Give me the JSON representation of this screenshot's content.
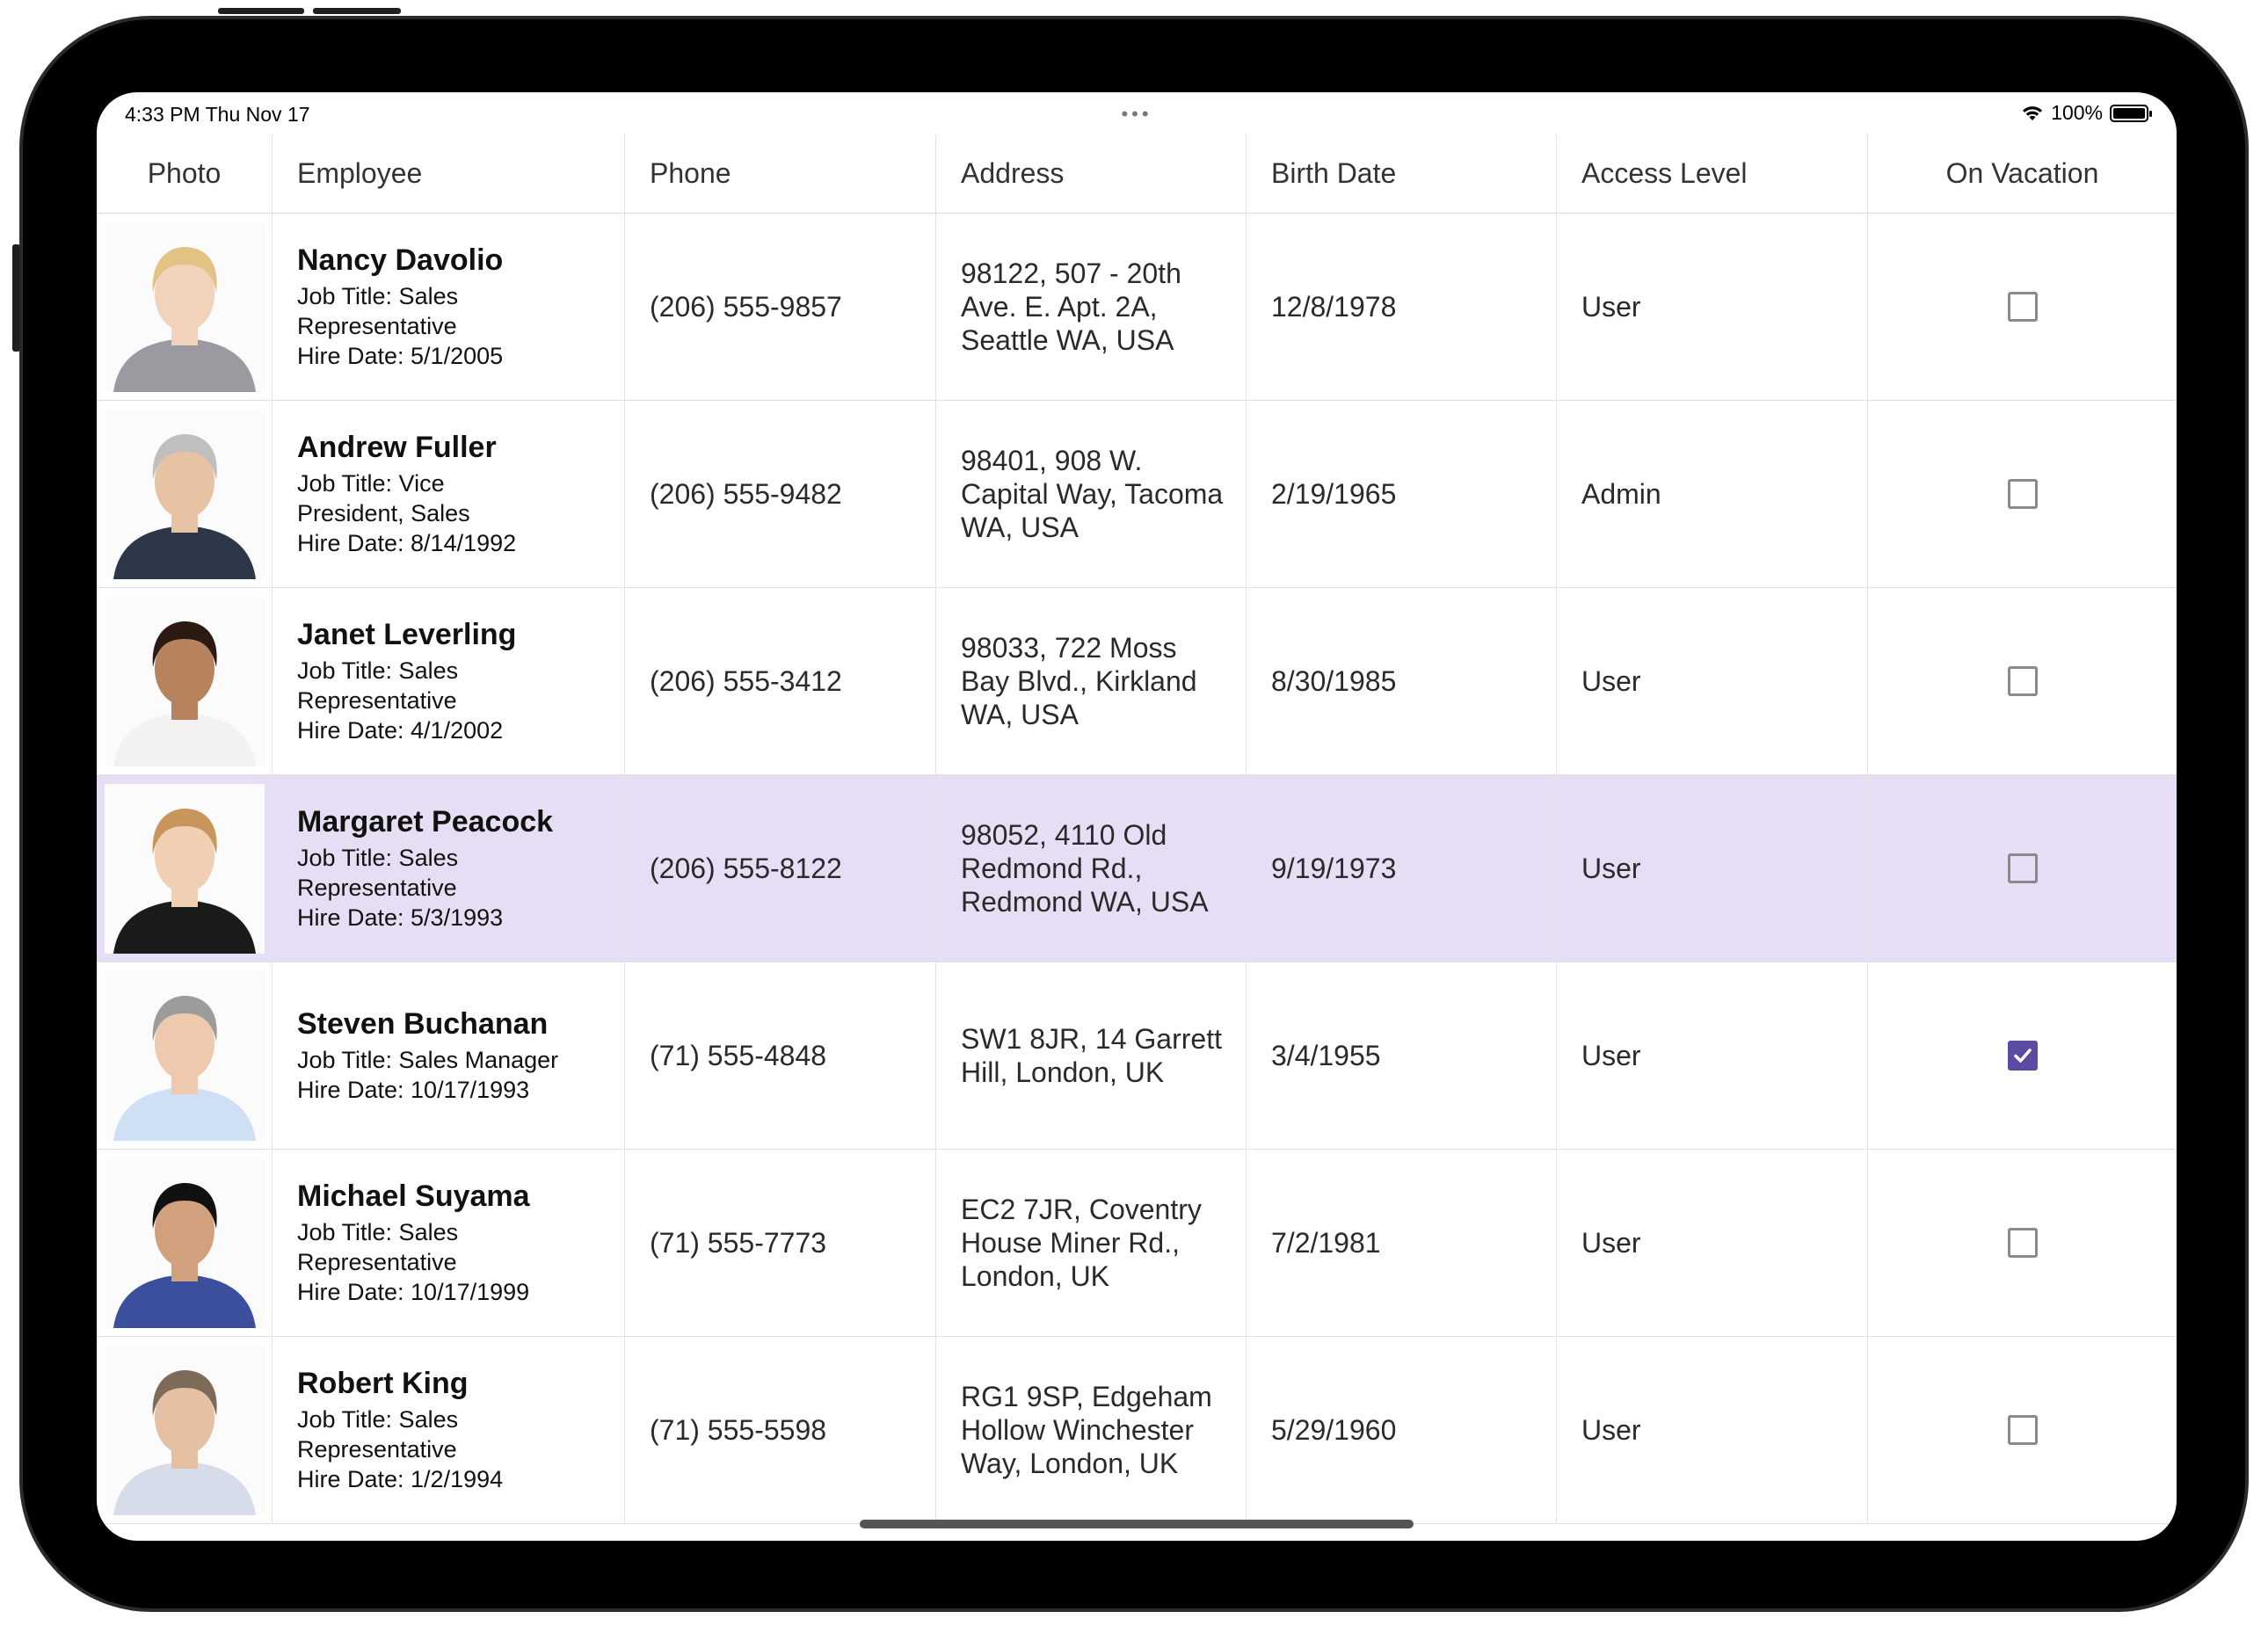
{
  "status_bar": {
    "time": "4:33 PM   Thu Nov 17",
    "dots": "•••",
    "battery": "100%"
  },
  "columns": [
    "Photo",
    "Employee",
    "Phone",
    "Address",
    "Birth Date",
    "Access Level",
    "On Vacation"
  ],
  "rows": [
    {
      "name": "Nancy Davolio",
      "job_line1": "Job Title: Sales",
      "job_line2": "Representative",
      "hire": "Hire Date: 5/1/2005",
      "phone": "(206) 555-9857",
      "address": "98122, 507 - 20th Ave. E. Apt. 2A, Seattle WA, USA",
      "birth": "12/8/1978",
      "access": "User",
      "on_vacation": false,
      "hair": "#e3c384",
      "suit": "#9a9aa0",
      "skin": "#f1d2bb"
    },
    {
      "name": "Andrew Fuller",
      "job_line1": "Job Title: Vice",
      "job_line2": "President, Sales",
      "hire": "Hire Date: 8/14/1992",
      "phone": "(206) 555-9482",
      "address": "98401, 908 W. Capital Way, Tacoma WA, USA",
      "birth": "2/19/1965",
      "access": "Admin",
      "on_vacation": false,
      "hair": "#bfbfbf",
      "suit": "#2c3848",
      "skin": "#e8c3a3"
    },
    {
      "name": "Janet Leverling",
      "job_line1": "Job Title: Sales",
      "job_line2": "Representative",
      "hire": "Hire Date: 4/1/2002",
      "phone": "(206) 555-3412",
      "address": "98033, 722 Moss Bay Blvd., Kirkland WA, USA",
      "birth": "8/30/1985",
      "access": "User",
      "on_vacation": false,
      "hair": "#2a1a12",
      "suit": "#f2f2f2",
      "skin": "#b7835f"
    },
    {
      "name": "Margaret Peacock",
      "job_line1": "Job Title: Sales",
      "job_line2": "Representative",
      "hire": "Hire Date: 5/3/1993",
      "phone": "(206) 555-8122",
      "address": "98052, 4110 Old Redmond Rd., Redmond WA, USA",
      "birth": "9/19/1973",
      "access": "User",
      "on_vacation": false,
      "selected": true,
      "hair": "#c8955a",
      "suit": "#1b1b1b",
      "skin": "#f0cfb3"
    },
    {
      "name": "Steven Buchanan",
      "job_line1": "Job Title: Sales Manager",
      "job_line2": "",
      "hire": "Hire Date: 10/17/1993",
      "phone": "(71) 555-4848",
      "address": "SW1 8JR, 14 Garrett Hill, London, UK",
      "birth": "3/4/1955",
      "access": "User",
      "on_vacation": true,
      "hair": "#9c9c9c",
      "suit": "#cfe0f5",
      "skin": "#eec9ae"
    },
    {
      "name": "Michael Suyama",
      "job_line1": "Job Title: Sales",
      "job_line2": "Representative",
      "hire": "Hire Date: 10/17/1999",
      "phone": "(71) 555-7773",
      "address": "EC2 7JR, Coventry House Miner Rd., London, UK",
      "birth": "7/2/1981",
      "access": "User",
      "on_vacation": false,
      "hair": "#111111",
      "suit": "#3b4f9c",
      "skin": "#d2a07c"
    },
    {
      "name": "Robert King",
      "job_line1": "Job Title: Sales",
      "job_line2": "Representative",
      "hire": "Hire Date: 1/2/1994",
      "phone": "(71) 555-5598",
      "address": "RG1 9SP, Edgeham Hollow Winchester Way, London, UK",
      "birth": "5/29/1960",
      "access": "User",
      "on_vacation": false,
      "hair": "#7d6a58",
      "suit": "#d6dcea",
      "skin": "#e6c0a2"
    }
  ],
  "colors": {
    "selected_row": "#e6def5",
    "checkbox_checked": "#5b4ba3"
  }
}
